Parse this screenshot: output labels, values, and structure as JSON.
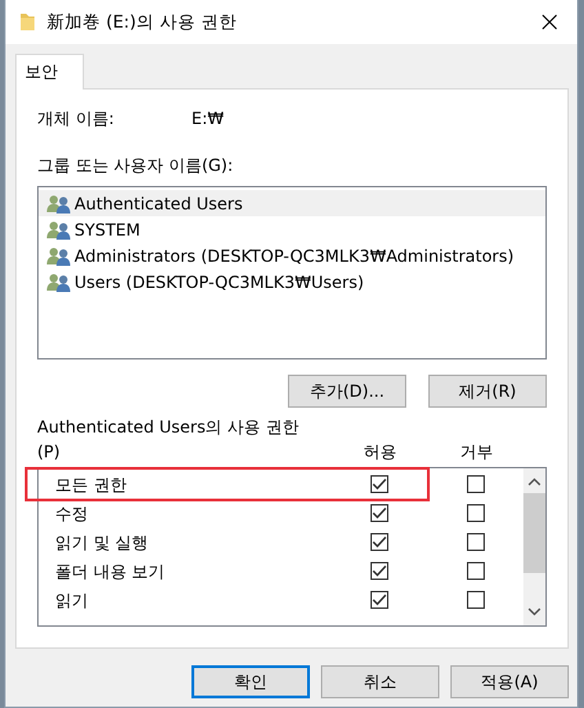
{
  "window": {
    "title": "新加巻 (E:)의 사용 권한"
  },
  "tabs": [
    {
      "label": "보안",
      "selected": true
    }
  ],
  "object_name": {
    "label": "개체 이름:",
    "value": "E:₩"
  },
  "users": {
    "label": "그룹 또는 사용자 이름(G):",
    "items": [
      {
        "name": "Authenticated Users",
        "selected": true
      },
      {
        "name": "SYSTEM",
        "selected": false
      },
      {
        "name": "Administrators (DESKTOP-QC3MLK3₩Administrators)",
        "selected": false
      },
      {
        "name": "Users (DESKTOP-QC3MLK3₩Users)",
        "selected": false
      }
    ]
  },
  "user_buttons": [
    "추가(D)...",
    "제거(R)"
  ],
  "permissions": {
    "label_line1": "Authenticated Users의 사용 권한",
    "label_line2": "(P)",
    "allow_header": "허용",
    "deny_header": "거부",
    "rows": [
      {
        "name": "모든 권한",
        "allow": true,
        "deny": false,
        "highlighted": true
      },
      {
        "name": "수정",
        "allow": true,
        "deny": false,
        "highlighted": false
      },
      {
        "name": "읽기 및 실행",
        "allow": true,
        "deny": false,
        "highlighted": false
      },
      {
        "name": "폴더 내용 보기",
        "allow": true,
        "deny": false,
        "highlighted": false
      },
      {
        "name": "읽기",
        "allow": true,
        "deny": false,
        "highlighted": false
      }
    ]
  },
  "buttons": [
    {
      "label": "확인",
      "default": true
    },
    {
      "label": "취소",
      "default": false
    },
    {
      "label": "적용(A)",
      "default": false
    }
  ]
}
